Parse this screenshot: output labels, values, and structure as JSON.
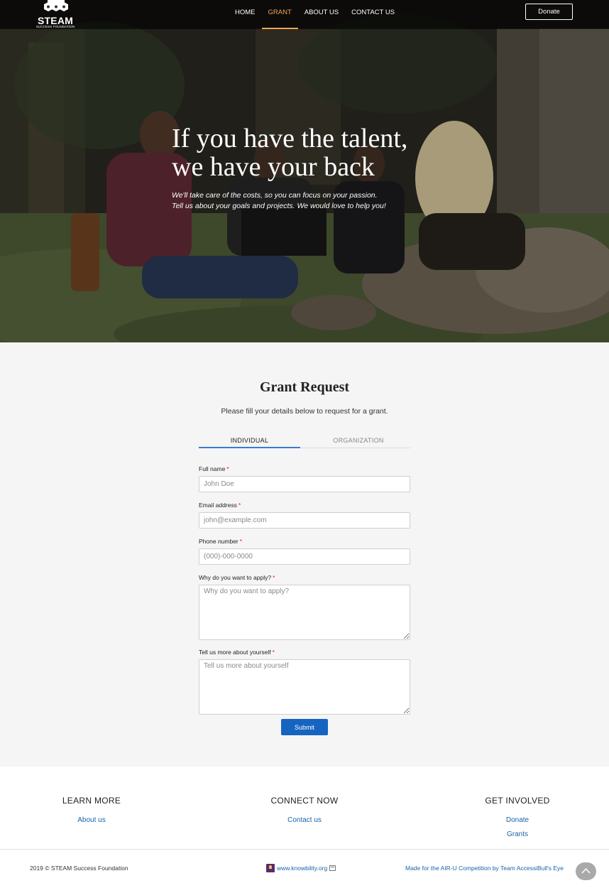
{
  "nav": {
    "logo_text": "STEAM",
    "logo_subtext": "SUCCESS FOUNDATION",
    "items": [
      {
        "label": "HOME",
        "active": false
      },
      {
        "label": "GRANT",
        "active": true
      },
      {
        "label": "ABOUT US",
        "active": false
      },
      {
        "label": "CONTACT US",
        "active": false
      }
    ],
    "donate_label": "Donate"
  },
  "hero": {
    "title_line1": "If you have the talent,",
    "title_line2": "we have your back",
    "sub_line1": "We'll take care of the costs, so you can focus on your passion.",
    "sub_line2": "Tell us about your goals and projects. We would love to help you!"
  },
  "form": {
    "title": "Grant Request",
    "description": "Please fill your details below to request for a grant.",
    "tabs": [
      {
        "label": "INDIVIDUAL",
        "active": true
      },
      {
        "label": "ORGANIZATION",
        "active": false
      }
    ],
    "fields": {
      "full_name": {
        "label": "Full name",
        "required": "*",
        "placeholder": "John Doe"
      },
      "email": {
        "label": "Email address",
        "required": "*",
        "placeholder": "john@example.com"
      },
      "phone": {
        "label": "Phone number",
        "required": "*",
        "placeholder": "(000)-000-0000"
      },
      "why_apply": {
        "label": "Why do you want to apply?",
        "required": "*",
        "placeholder": "Why do you want to apply?"
      },
      "about_yourself": {
        "label": "Tell us more about yourself",
        "required": "*",
        "placeholder": "Tell us more about yourself"
      }
    },
    "submit_label": "Submit"
  },
  "footer": {
    "learn_more": {
      "heading": "LEARN MORE",
      "links": [
        "About us"
      ]
    },
    "connect_now": {
      "heading": "CONNECT NOW",
      "links": [
        "Contact us"
      ]
    },
    "get_involved": {
      "heading": "GET INVOLVED",
      "links": [
        "Donate",
        "Grants"
      ]
    },
    "copyright": "2019 © STEAM Success Foundation",
    "knowbility_link": "www.knowbility.org",
    "made_for": "Made for the AIR-U Competition by Team AccessiBull's Eye"
  },
  "colors": {
    "accent_orange": "#f2a355",
    "primary_blue": "#1565c0",
    "link_blue": "#1a63a8",
    "required_red": "#d9212c",
    "form_bg": "#f5f5f5"
  }
}
